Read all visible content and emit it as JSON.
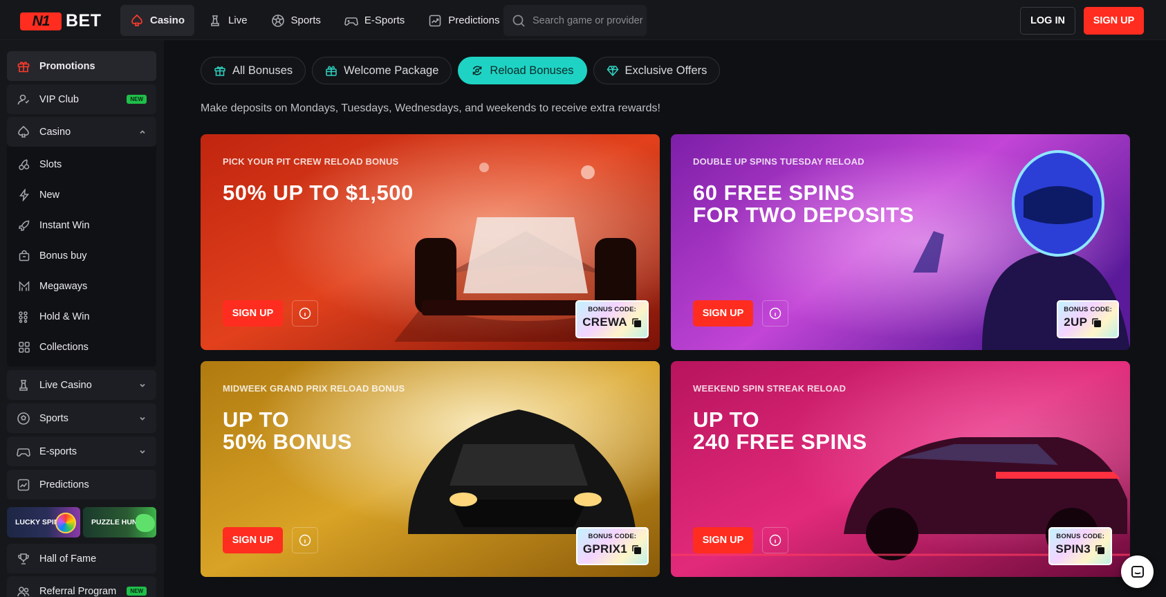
{
  "brand": {
    "logo_mark": "N1",
    "logo_text": "BET"
  },
  "header": {
    "nav": [
      {
        "label": "Casino",
        "icon": "spade-icon",
        "active": true
      },
      {
        "label": "Live",
        "icon": "chess-piece-icon"
      },
      {
        "label": "Sports",
        "icon": "soccer-ball-icon"
      },
      {
        "label": "E-Sports",
        "icon": "gamepad-icon"
      },
      {
        "label": "Predictions",
        "icon": "trend-chart-icon"
      }
    ],
    "search_placeholder": "Search game or provider",
    "login_label": "LOG IN",
    "signup_label": "SIGN UP"
  },
  "sidebar": {
    "promotions": "Promotions",
    "vip": "VIP Club",
    "vip_badge": "NEW",
    "casino": "Casino",
    "casino_sub": [
      "Slots",
      "New",
      "Instant Win",
      "Bonus buy",
      "Megaways",
      "Hold & Win",
      "Collections"
    ],
    "live_casino": "Live Casino",
    "sports": "Sports",
    "esports": "E-sports",
    "predictions": "Predictions",
    "tiles": [
      "LUCKY SPIN",
      "PUZZLE HUNT"
    ],
    "hall_of_fame": "Hall of Fame",
    "referral": "Referral Program"
  },
  "main": {
    "tabs": [
      {
        "label": "All Bonuses",
        "icon": "gift-icon"
      },
      {
        "label": "Welcome Package",
        "icon": "gift-box-icon"
      },
      {
        "label": "Reload Bonuses",
        "icon": "reload-icon",
        "active": true
      },
      {
        "label": "Exclusive Offers",
        "icon": "diamond-icon"
      }
    ],
    "intro": "Make deposits on Mondays, Tuesdays, Wednesdays, and weekends to receive extra rewards!",
    "cards": [
      {
        "label": "PICK YOUR PIT CREW RELOAD BONUS",
        "headline": "50% UP TO $1,500",
        "signup": "SIGN UP",
        "code_label": "BONUS CODE:",
        "code": "CREWA"
      },
      {
        "label": "DOUBLE UP SPINS TUESDAY RELOAD",
        "headline": "60 FREE SPINS\nFOR TWO DEPOSITS",
        "signup": "SIGN UP",
        "code_label": "BONUS CODE:",
        "code": "2UP"
      },
      {
        "label": "MIDWEEK GRAND PRIX RELOAD BONUS",
        "headline": "UP TO\n50% BONUS",
        "signup": "SIGN UP",
        "code_label": "BONUS CODE:",
        "code": "GPRIX1"
      },
      {
        "label": "WEEKEND SPIN STREAK RELOAD",
        "headline": "UP TO\n240 FREE SPINS",
        "signup": "SIGN UP",
        "code_label": "BONUS CODE:",
        "code": "SPIN3"
      }
    ]
  },
  "colors": {
    "accent": "#ff2d1f",
    "teal": "#1fd3c4",
    "bg": "#0f1013",
    "panel": "#16171b"
  }
}
